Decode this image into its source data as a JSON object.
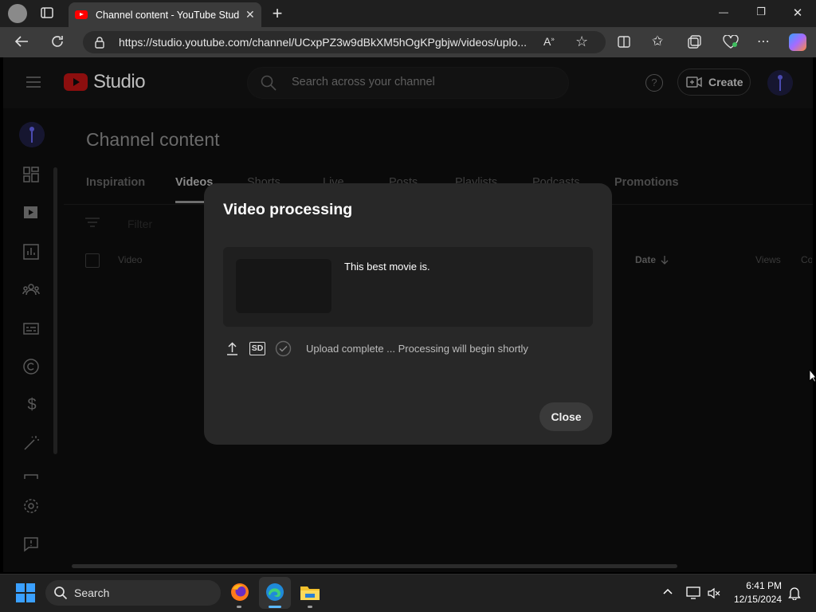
{
  "browser": {
    "tab_title": "Channel content - YouTube Studio",
    "tab_close": "✕",
    "new_tab": "+",
    "url": "https://studio.youtube.com/channel/UCxpPZ3w9dBkXM5hOgKPgbjw/videos/uplo...",
    "window_controls": {
      "minimize": "—",
      "restore": "❐",
      "close": "✕"
    }
  },
  "studio": {
    "logo_text": "Studio",
    "search_placeholder": "Search across your channel",
    "create_label": "Create",
    "page_title": "Channel content",
    "content_tabs": [
      "Inspiration",
      "Videos",
      "Shorts",
      "Live",
      "Posts",
      "Playlists",
      "Podcasts",
      "Promotions"
    ],
    "active_tab": "Videos",
    "filter_label": "Filter",
    "table_headers": {
      "video": "Video",
      "date": "Date",
      "views": "Views",
      "comments": "Co"
    },
    "sidebar_icons": [
      "dashboard-icon",
      "content-icon",
      "analytics-icon",
      "community-icon",
      "subtitles-icon",
      "copyright-icon",
      "earn-icon",
      "customization-icon",
      "audio-library-icon",
      "settings-icon",
      "feedback-icon"
    ]
  },
  "dialog": {
    "title": "Video processing",
    "video_title": "This best movie is.",
    "quality_badge": "SD",
    "status": "Upload complete ... Processing will begin shortly",
    "close_label": "Close"
  },
  "taskbar": {
    "search_label": "Search",
    "time": "6:41 PM",
    "date": "12/15/2024"
  },
  "colors": {
    "youtube_red": "#ff0000",
    "dialog_bg": "#282828",
    "page_bg": "#0a0a0a"
  }
}
